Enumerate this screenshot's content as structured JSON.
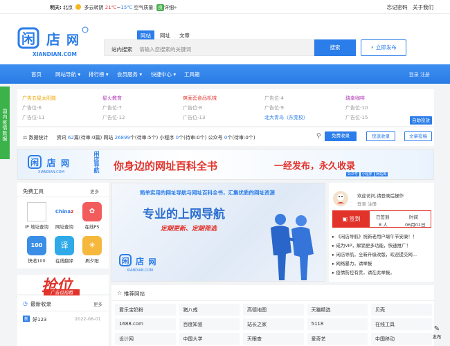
{
  "topbar": {
    "weather_label": "明天:",
    "city": "北京",
    "condition": "多云转阴",
    "temp_high": "21℃",
    "temp_sep": "~",
    "temp_low": "15℃",
    "aqi_label": "空气质量:",
    "aqi_value": "良",
    "aqi_detail": "详细»",
    "links": [
      "忘记密码",
      "关于我们"
    ]
  },
  "header": {
    "logo_text": "XIANDIAN.COM",
    "tabs": [
      "网站",
      "网址",
      "文章"
    ],
    "active_tab": "网站",
    "search_label": "站内搜索",
    "search_placeholder": "请输入您搜索的关键词",
    "search_button": "搜索",
    "publish_button": "立即发布"
  },
  "nav": {
    "items": [
      "首页",
      "网站导航 ▾",
      "排行榜 ▾",
      "会员服务 ▾",
      "快捷中心 ▾",
      "工具箱"
    ],
    "login": "登录",
    "register": "注册"
  },
  "side_tab": "国内疫情数据",
  "ads": {
    "rows": [
      [
        {
          "text": "广告五星太阳能",
          "color": "#f0a500"
        },
        {
          "text": "星火教育",
          "color": "#b03ab3"
        },
        {
          "text": "爽面歪食品机械",
          "color": "#e0403a"
        },
        {
          "text": "广告位-4",
          "color": "#999999"
        },
        {
          "text": "瑞幸咖啡",
          "color": "#b03ab3"
        }
      ],
      [
        {
          "text": "广告位-6",
          "color": "#999999"
        },
        {
          "text": "广告位-7",
          "color": "#999999"
        },
        {
          "text": "广告位-8",
          "color": "#999999"
        },
        {
          "text": "广告位-9",
          "color": "#999999"
        },
        {
          "text": "广告位-10",
          "color": "#999999"
        }
      ],
      [
        {
          "text": "广告位-11",
          "color": "#999999"
        },
        {
          "text": "广告位-12",
          "color": "#999999"
        },
        {
          "text": "广告位-13",
          "color": "#999999"
        },
        {
          "text": "北大青鸟（东莞校）",
          "color": "#2b7de9"
        },
        {
          "text": "广告位-15",
          "color": "#999999"
        }
      ]
    ],
    "auto_post": "自助投放"
  },
  "stats": {
    "label": "数据统计",
    "text_a": "资讯 ",
    "num_a": "62",
    "text_b": "篇(待审:0篇)  网站 ",
    "num_b": "26899",
    "text_c": "个(待审:5个)  小程序 ",
    "num_c": "0",
    "text_d": "个(待审:0个)  公众号 ",
    "num_d": "0",
    "text_e": "个(待审:0个)",
    "btn_free": "免费收录",
    "btn_fast": "快速收录",
    "btn_article": "文章投稿"
  },
  "banner": {
    "vertical": "闲店导航",
    "slogan": "你身边的网址百科全书",
    "slogan2": "一经发布，永久收录",
    "tags": [
      "公众号",
      "小程序",
      "网站库"
    ]
  },
  "free_tools": {
    "title": "免费工具",
    "more": "更多",
    "items": [
      "IP 地址查询",
      "网址查询",
      "在线PS",
      "快递100",
      "在线翻译",
      "刷夕阳"
    ]
  },
  "hero": {
    "line1": "简单实用的网址导航与网址百科全书，汇集优质的网址资源",
    "line2": "专业的上网导航",
    "line3": "定期更新、定期筛选",
    "logo_text": "XIANDIAN.COM"
  },
  "user": {
    "welcome": "欢迎访问,请登录后操作",
    "login": "登录",
    "register": "注册",
    "sign_button": "签到",
    "signed_label": "已签到",
    "signed_count": "8 人",
    "time_label": "时间",
    "time_value": "06月01日",
    "notices": [
      "《闲店导航》祝新老用户端午节安康！！",
      "成为VIP，解锁更多功能，快速推广！",
      "闲店导航，全新升级改版，欢迎提交网...",
      "网络暴力，请举报",
      "疫情防控有责，请在此举报。"
    ]
  },
  "ad_promo": {
    "big": "抢位",
    "small": "广告位招租"
  },
  "recent": {
    "title": "最新收录",
    "more": "更多",
    "item_badge": "新",
    "item_name": "好123",
    "item_date": "2022-06-01"
  },
  "recommend": {
    "title": "推荐网站",
    "rows": [
      [
        "君乐宝奶粉",
        "猪八戒",
        "高德地图",
        "天猫精选",
        "贝壳"
      ],
      [
        "1688.com",
        "百度知道",
        "站长之家",
        "5118",
        "在线工具"
      ],
      [
        "设计网",
        "中国大学",
        "天眼查",
        "爱奇艺",
        "中国移动"
      ]
    ]
  },
  "float_publish": "发布"
}
